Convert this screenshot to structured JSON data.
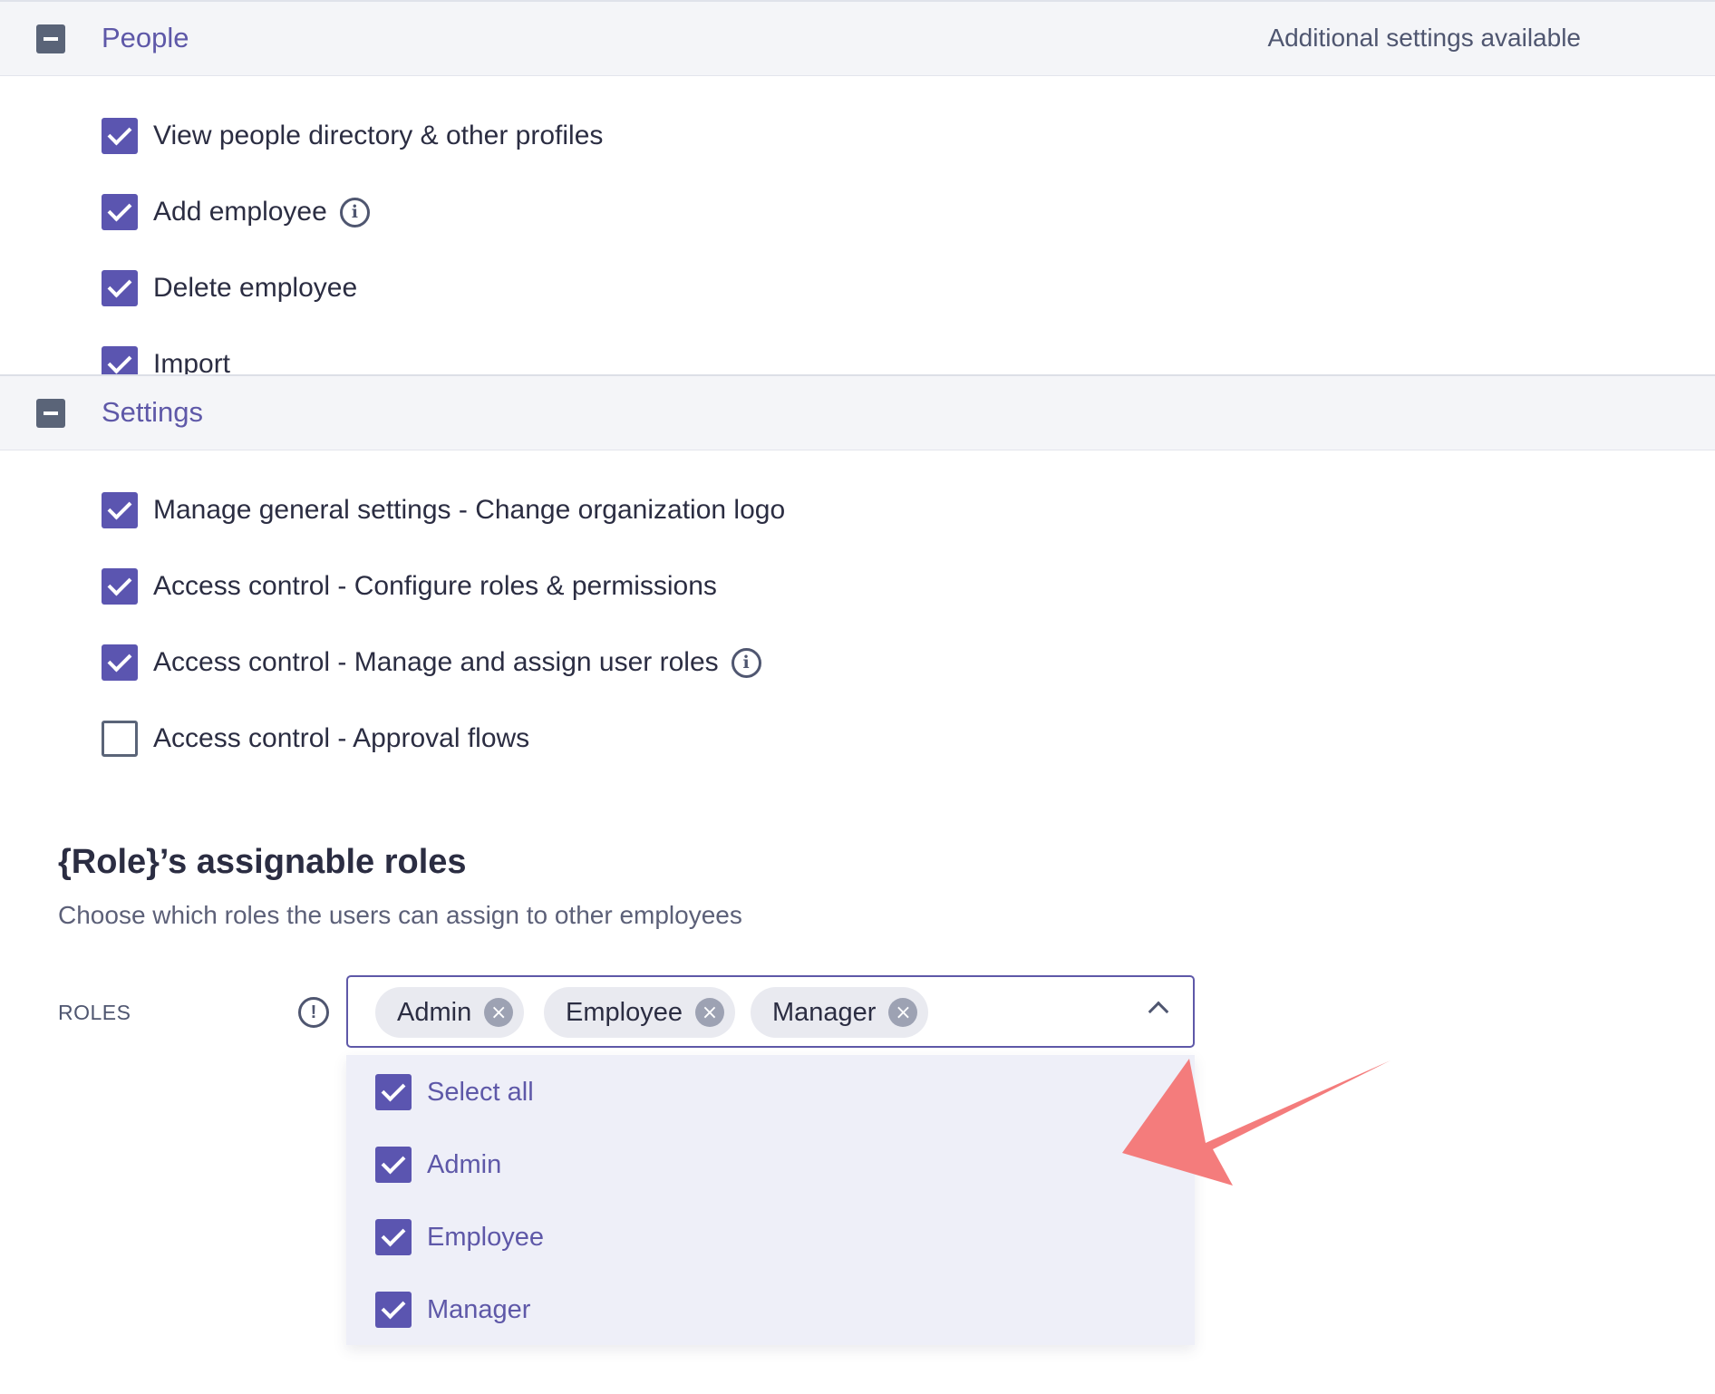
{
  "people_section": {
    "title": "People",
    "extra": "Additional settings available",
    "permissions": [
      {
        "label": "View people directory & other profiles",
        "checked": true,
        "info": false
      },
      {
        "label": "Add employee",
        "checked": true,
        "info": true
      },
      {
        "label": "Delete employee",
        "checked": true,
        "info": false
      },
      {
        "label": "Import",
        "checked": true,
        "info": false
      }
    ]
  },
  "settings_section": {
    "title": "Settings",
    "permissions": [
      {
        "label": "Manage general settings - Change organization logo",
        "checked": true,
        "info": false
      },
      {
        "label": "Access control - Configure roles & permissions",
        "checked": true,
        "info": false
      },
      {
        "label": "Access control - Manage and assign user roles",
        "checked": true,
        "info": true
      },
      {
        "label": "Access control - Approval flows",
        "checked": false,
        "info": false
      }
    ]
  },
  "assignable": {
    "title": "{Role}’s assignable roles",
    "subtitle": "Choose which roles the users can assign to other employees",
    "roles_label": "ROLES",
    "selected_chips": [
      "Admin",
      "Employee",
      "Manager"
    ],
    "dropdown_options": [
      {
        "label": "Select all",
        "checked": true
      },
      {
        "label": "Admin",
        "checked": true
      },
      {
        "label": "Employee",
        "checked": true
      },
      {
        "label": "Manager",
        "checked": true
      }
    ]
  },
  "icons": {
    "collapse": "minus-square-icon",
    "info": "info-circle-icon",
    "warning": "exclamation-circle-icon",
    "remove": "close-circle-icon",
    "chevron": "chevron-up-icon",
    "annotation": "arrow-annotation-icon"
  },
  "colors": {
    "accent": "#5b55b0",
    "header_bg": "#f4f5f8",
    "dropdown_bg": "#eeeff8",
    "annotation_arrow": "#f47c7c"
  }
}
